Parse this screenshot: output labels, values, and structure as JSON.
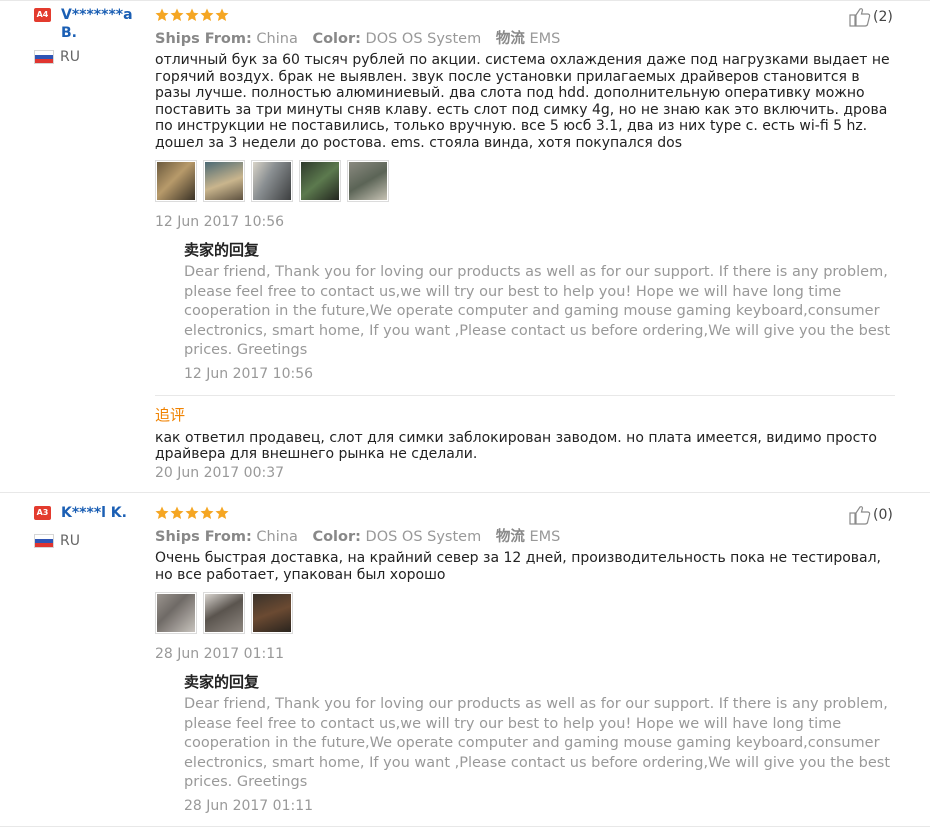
{
  "reviews": [
    {
      "level": "A4",
      "user": "V*******a B.",
      "country": "RU",
      "helpful_count": "(2)",
      "meta": {
        "ships_from_label": "Ships From:",
        "ships_from": "China",
        "color_label": "Color:",
        "color": "DOS OS System",
        "logistics_label": "物流",
        "logistics": "EMS"
      },
      "text": "отличный бук за 60 тысяч рублей по акции. система охлаждения даже под нагрузками выдает не горячий воздух. брак не выявлен. звук после установки прилагаемых драйверов становится в разы лучше. полностью алюминиевый. два слота под hdd. дополнительную оперативку можно поставить за три минуты сняв клаву. есть слот под симку 4g, но не знаю как это включить. дрова по инструкции не поставились, только вручную. все 5 юсб 3.1, два из них type c. есть wi-fi 5 hz. дошел за 3 недели до ростова. ems. стояла винда, хотя покупался dos",
      "date": "12 Jun 2017 10:56",
      "reply_title": "卖家的回复",
      "reply_text": "Dear friend, Thank you for loving our products as well as for our support. If there is any problem, please feel free to contact us,we will try our best to help you! Hope we will have long time cooperation in the future,We operate computer and gaming mouse gaming keyboard,consumer electronics, smart home, If you want ,Please contact us before ordering,We will give you the best prices. Greetings",
      "reply_date": "12 Jun 2017 10:56",
      "followup_title": "追评",
      "followup_text": "как ответил продавец, слот для симки заблокирован заводом. но плата имеется, видимо просто драйвера для внешнего рынка не сделали.",
      "followup_date": "20 Jun 2017 00:37"
    },
    {
      "level": "A3",
      "user": "K****l K.",
      "country": "RU",
      "helpful_count": "(0)",
      "meta": {
        "ships_from_label": "Ships From:",
        "ships_from": "China",
        "color_label": "Color:",
        "color": "DOS OS System",
        "logistics_label": "物流",
        "logistics": "EMS"
      },
      "text": "Очень быстрая доставка, на крайний север за 12 дней, производительность пока не тестировал, но все работает, упакован был хорошо",
      "date": "28 Jun 2017 01:11",
      "reply_title": "卖家的回复",
      "reply_text": "Dear friend, Thank you for loving our products as well as for our support. If there is any problem, please feel free to contact us,we will try our best to help you! Hope we will have long time cooperation in the future,We operate computer and gaming mouse gaming keyboard,consumer electronics, smart home, If you want ,Please contact us before ordering,We will give you the best prices. Greetings",
      "reply_date": "28 Jun 2017 01:11"
    }
  ],
  "colors": {
    "star": "#f5a623",
    "badge": "#e33b2e",
    "username": "#1b5fb4",
    "followup": "#f08200",
    "muted": "#999999"
  },
  "icons": {
    "star": "star-icon",
    "helpful": "thumbs-up-icon",
    "flag": "russia-flag-icon"
  }
}
